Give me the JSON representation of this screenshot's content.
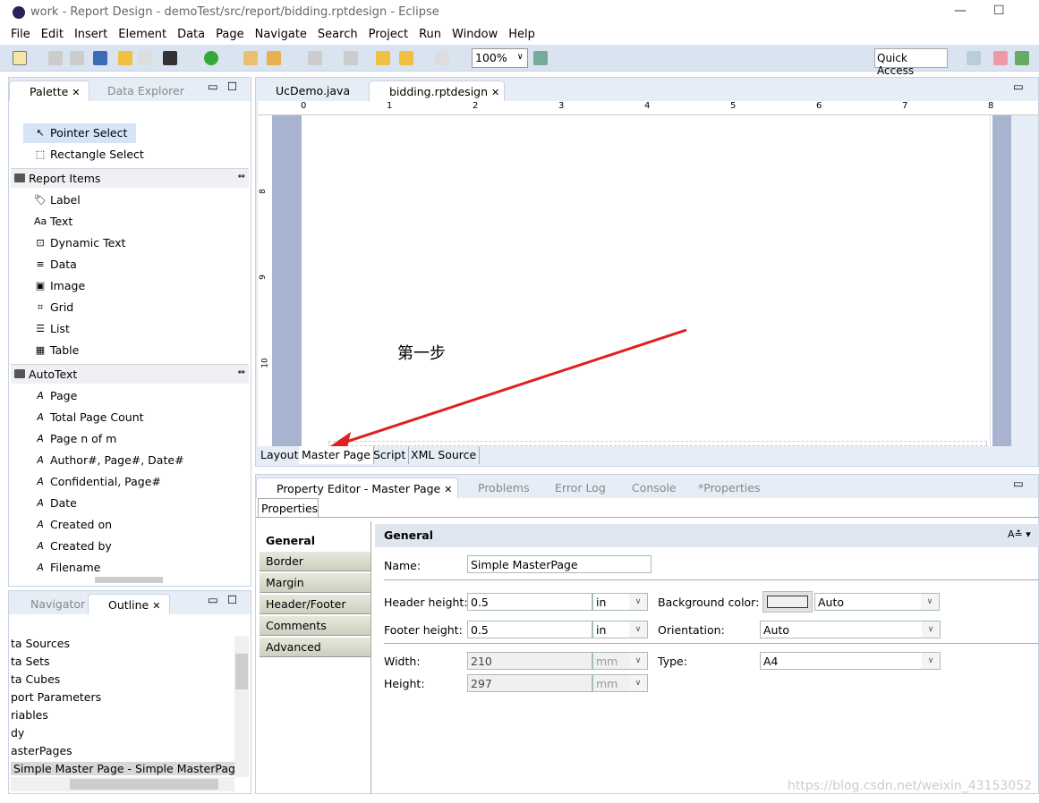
{
  "window": {
    "title": "work - Report Design - demoTest/src/report/bidding.rptdesign - Eclipse"
  },
  "menu": [
    "File",
    "Edit",
    "Insert",
    "Element",
    "Data",
    "Page",
    "Navigate",
    "Search",
    "Project",
    "Run",
    "Window",
    "Help"
  ],
  "toolbar": {
    "zoom": "100%",
    "quick_access": "Quick Access"
  },
  "palette": {
    "tabs": [
      "Palette",
      "Data Explorer"
    ],
    "tools": [
      "Pointer Select",
      "Rectangle Select"
    ],
    "report_items_header": "Report Items",
    "report_items": [
      "Label",
      "Text",
      "Dynamic Text",
      "Data",
      "Image",
      "Grid",
      "List",
      "Table"
    ],
    "autotext_header": "AutoText",
    "autotext": [
      "Page",
      "Total Page Count",
      "Page n of m",
      "Author#, Page#, Date#",
      "Confidential, Page#",
      "Date",
      "Created on",
      "Created by",
      "Filename"
    ]
  },
  "outline": {
    "tabs": [
      "Navigator",
      "Outline"
    ],
    "items": [
      "ta Sources",
      "ta Sets",
      "ta Cubes",
      "port Parameters",
      "riables",
      "dy",
      "asterPages",
      "Simple Master Page - Simple MasterPage"
    ]
  },
  "editor": {
    "tabs": [
      "UcDemo.java",
      "bidding.rptdesign"
    ],
    "ruler_top": [
      "0",
      "1",
      "2",
      "3",
      "4",
      "5",
      "6",
      "7",
      "8"
    ],
    "ruler_left": [
      "8",
      "9",
      "10"
    ],
    "annotation": "第一步",
    "annotation_color": "#e02020",
    "bottom_tabs": [
      "Layout",
      "Master Page",
      "Script",
      "XML Source"
    ]
  },
  "property_editor": {
    "tabs": [
      "Property Editor - Master Page",
      "Problems",
      "Error Log",
      "Console",
      "*Properties"
    ],
    "subtab": "Properties",
    "categories": [
      "General",
      "Border",
      "Margin",
      "Header/Footer",
      "Comments",
      "Advanced"
    ],
    "section": "General",
    "fields": {
      "name_label": "Name:",
      "name": "Simple MasterPage",
      "header_height_label": "Header height:",
      "header_height": "0.5",
      "header_unit": "in",
      "footer_height_label": "Footer height:",
      "footer_height": "0.5",
      "footer_unit": "in",
      "width_label": "Width:",
      "width": "210",
      "width_unit": "mm",
      "height_label": "Height:",
      "height": "297",
      "height_unit": "mm",
      "bg_color_label": "Background color:",
      "bg_color": "Auto",
      "orientation_label": "Orientation:",
      "orientation": "Auto",
      "type_label": "Type:",
      "type": "A4"
    }
  },
  "watermark": "https://blog.csdn.net/weixin_43153052"
}
